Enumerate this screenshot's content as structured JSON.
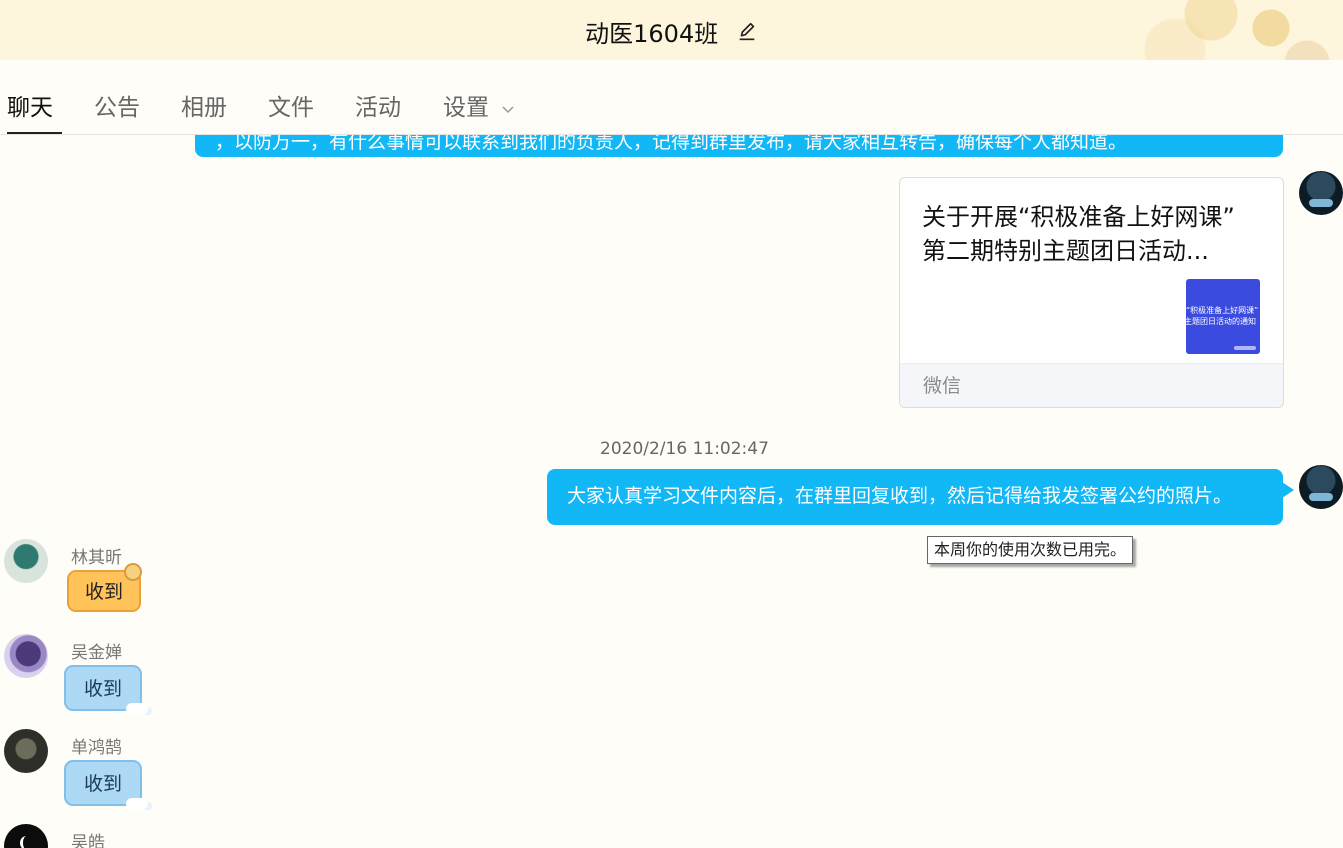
{
  "header": {
    "title": "动医1604班",
    "edit_icon": "pencil-icon"
  },
  "tabs": [
    {
      "label": "聊天"
    },
    {
      "label": "公告"
    },
    {
      "label": "相册"
    },
    {
      "label": "文件"
    },
    {
      "label": "活动"
    },
    {
      "label": "设置"
    }
  ],
  "chat": {
    "cut_message": "，以防万一，有什么事情可以联系到我们的负责人，记得到群里发布，请大家相互转告，确保每个人都知道。",
    "card": {
      "title": "关于开展“积极准备上好网课” 第二期特别主题团日活动...",
      "thumb_line1": "“积极准备上好网课”",
      "thumb_line2": "主题团日活动的通知",
      "source": "微信"
    },
    "timestamp": "2020/2/16 11:02:47",
    "main_message": "大家认真学习文件内容后，在群里回复收到，然后记得给我发签署公约的照片。",
    "members": [
      {
        "name": "林其昕",
        "reply": "收到"
      },
      {
        "name": "吴金婵",
        "reply": "收到"
      },
      {
        "name": "单鸿鹄",
        "reply": "收到"
      },
      {
        "name": "吴皓"
      }
    ]
  },
  "tooltip": "本周你的使用次数已用完。",
  "colors": {
    "accent_blue": "#12b7f5",
    "header_bg": "#fdf6dc",
    "orange_bubble": "#ffc35a",
    "light_blue_bubble": "#aed9f5"
  }
}
